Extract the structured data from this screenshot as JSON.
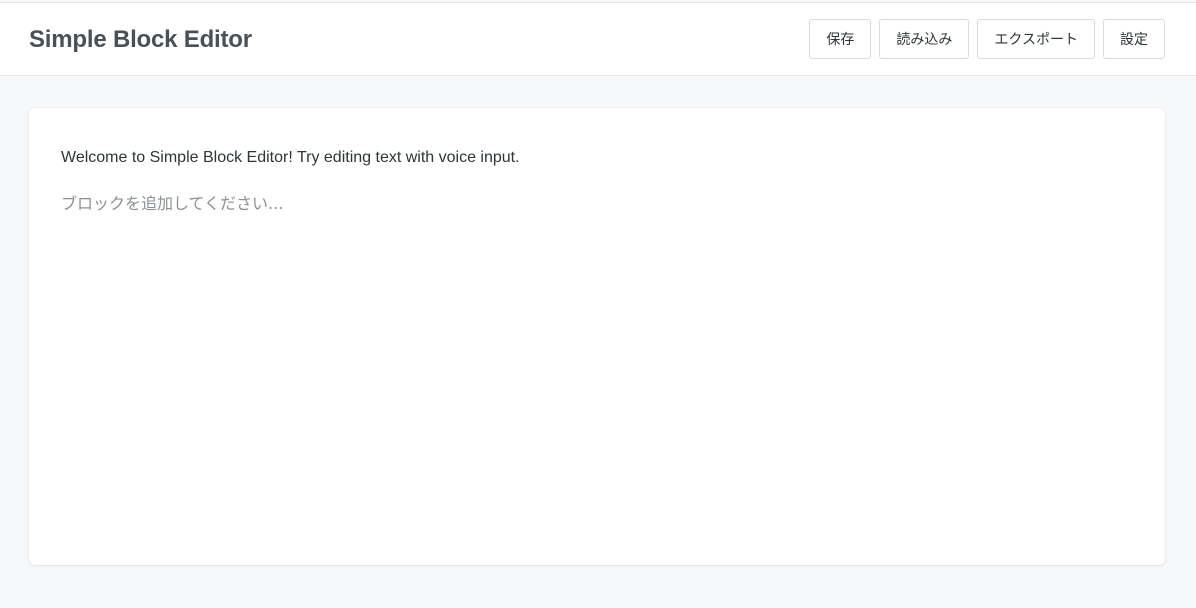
{
  "header": {
    "title": "Simple Block Editor",
    "toolbar": {
      "save_label": "保存",
      "load_label": "読み込み",
      "export_label": "エクスポート",
      "settings_label": "設定"
    }
  },
  "editor": {
    "blocks": [
      {
        "text": "Welcome to Simple Block Editor! Try editing text with voice input."
      }
    ],
    "new_block_placeholder": "ブロックを追加してください..."
  },
  "colors": {
    "page_background": "#f7f8fa",
    "header_background": "#ffffff",
    "title_text": "#4a5056",
    "placeholder_text": "#8b9096",
    "button_border": "#d7dbe0"
  }
}
